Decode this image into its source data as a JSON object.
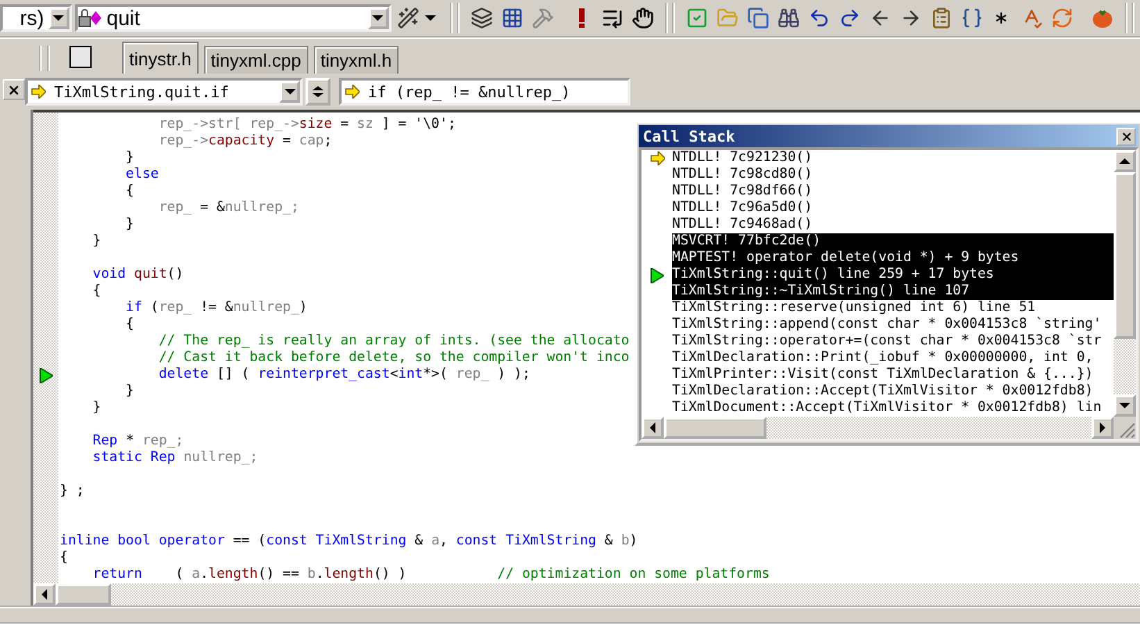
{
  "toolbar": {
    "config_combo": {
      "value": "rs)"
    },
    "symbol_combo": {
      "value": "quit"
    }
  },
  "tabs": [
    {
      "label": "tinystr.h",
      "selected": true
    },
    {
      "label": "tinyxml.cpp",
      "selected": false
    },
    {
      "label": "tinyxml.h",
      "selected": false
    }
  ],
  "wizard_bar": {
    "scope": "TiXmlString.quit.if",
    "member": "if (rep_ != &nullrep_)"
  },
  "editor": {
    "lines": [
      {
        "execution_mark": false,
        "tokens": [
          {
            "kind": "var",
            "text": "            rep_->str[ rep_->"
          },
          {
            "kind": "member",
            "text": "size"
          },
          {
            "kind": "plain",
            "text": " = "
          },
          {
            "kind": "var",
            "text": "sz"
          },
          {
            "kind": "plain",
            "text": " ] = '\\0';"
          }
        ]
      },
      {
        "execution_mark": false,
        "tokens": [
          {
            "kind": "var",
            "text": "            rep_->"
          },
          {
            "kind": "member",
            "text": "capacity"
          },
          {
            "kind": "plain",
            "text": " = "
          },
          {
            "kind": "var",
            "text": "cap"
          },
          {
            "kind": "plain",
            "text": ";"
          }
        ]
      },
      {
        "execution_mark": false,
        "tokens": [
          {
            "kind": "plain",
            "text": "        }"
          }
        ]
      },
      {
        "execution_mark": false,
        "tokens": [
          {
            "kind": "keyword",
            "text": "        else"
          }
        ]
      },
      {
        "execution_mark": false,
        "tokens": [
          {
            "kind": "plain",
            "text": "        {"
          }
        ]
      },
      {
        "execution_mark": false,
        "tokens": [
          {
            "kind": "var",
            "text": "            rep_"
          },
          {
            "kind": "plain",
            "text": " = &"
          },
          {
            "kind": "var",
            "text": "nullrep_;"
          }
        ]
      },
      {
        "execution_mark": false,
        "tokens": [
          {
            "kind": "plain",
            "text": "        }"
          }
        ]
      },
      {
        "execution_mark": false,
        "tokens": [
          {
            "kind": "plain",
            "text": "    }"
          }
        ]
      },
      {
        "execution_mark": false
      },
      {
        "execution_mark": false,
        "tokens": [
          {
            "kind": "keyword",
            "text": "    void "
          },
          {
            "kind": "member",
            "text": "quit"
          },
          {
            "kind": "plain",
            "text": "()"
          }
        ]
      },
      {
        "execution_mark": false,
        "tokens": [
          {
            "kind": "plain",
            "text": "    {"
          }
        ]
      },
      {
        "execution_mark": false,
        "tokens": [
          {
            "kind": "keyword",
            "text": "        if"
          },
          {
            "kind": "plain",
            "text": " ("
          },
          {
            "kind": "var",
            "text": "rep_"
          },
          {
            "kind": "plain",
            "text": " != &"
          },
          {
            "kind": "var",
            "text": "nullrep_"
          },
          {
            "kind": "plain",
            "text": ")"
          }
        ]
      },
      {
        "execution_mark": false,
        "tokens": [
          {
            "kind": "plain",
            "text": "        {"
          }
        ]
      },
      {
        "execution_mark": false,
        "tokens": [
          {
            "kind": "comment",
            "text": "            // The rep_ is really an array of ints. (see the allocato"
          }
        ]
      },
      {
        "execution_mark": false,
        "tokens": [
          {
            "kind": "comment",
            "text": "            // Cast it back before delete, so the compiler won't inco"
          }
        ]
      },
      {
        "execution_mark": true,
        "tokens": [
          {
            "kind": "keyword",
            "text": "            delete"
          },
          {
            "kind": "plain",
            "text": " [] ( "
          },
          {
            "kind": "keyword",
            "text": "reinterpret_cast"
          },
          {
            "kind": "plain",
            "text": "<"
          },
          {
            "kind": "keyword",
            "text": "int"
          },
          {
            "kind": "plain",
            "text": "*>( "
          },
          {
            "kind": "var",
            "text": "rep_"
          },
          {
            "kind": "plain",
            "text": " ) );"
          }
        ]
      },
      {
        "execution_mark": false,
        "tokens": [
          {
            "kind": "plain",
            "text": "        }"
          }
        ]
      },
      {
        "execution_mark": false,
        "tokens": [
          {
            "kind": "plain",
            "text": "    }"
          }
        ]
      },
      {
        "execution_mark": false
      },
      {
        "execution_mark": false,
        "tokens": [
          {
            "kind": "keyword",
            "text": "    Rep"
          },
          {
            "kind": "plain",
            "text": " * "
          },
          {
            "kind": "var",
            "text": "rep_;"
          }
        ]
      },
      {
        "execution_mark": false,
        "tokens": [
          {
            "kind": "keyword",
            "text": "    static Rep "
          },
          {
            "kind": "var",
            "text": "nullrep_;"
          }
        ]
      },
      {
        "execution_mark": false
      },
      {
        "execution_mark": false,
        "tokens": [
          {
            "kind": "plain",
            "text": "} ;"
          }
        ]
      },
      {
        "execution_mark": false
      },
      {
        "execution_mark": false
      },
      {
        "execution_mark": false,
        "tokens": [
          {
            "kind": "keyword",
            "text": "inline bool operator"
          },
          {
            "kind": "plain",
            "text": " == ("
          },
          {
            "kind": "keyword",
            "text": "const TiXmlString"
          },
          {
            "kind": "plain",
            "text": " & "
          },
          {
            "kind": "var",
            "text": "a"
          },
          {
            "kind": "plain",
            "text": ", "
          },
          {
            "kind": "keyword",
            "text": "const TiXmlString"
          },
          {
            "kind": "plain",
            "text": " & "
          },
          {
            "kind": "var",
            "text": "b"
          },
          {
            "kind": "plain",
            "text": ")"
          }
        ]
      },
      {
        "execution_mark": false,
        "tokens": [
          {
            "kind": "plain",
            "text": "{"
          }
        ]
      },
      {
        "execution_mark": false,
        "tokens": [
          {
            "kind": "keyword",
            "text": "    return"
          },
          {
            "kind": "plain",
            "text": "    ( "
          },
          {
            "kind": "var",
            "text": "a"
          },
          {
            "kind": "plain",
            "text": "."
          },
          {
            "kind": "member",
            "text": "length"
          },
          {
            "kind": "plain",
            "text": "() == "
          },
          {
            "kind": "var",
            "text": "b"
          },
          {
            "kind": "plain",
            "text": "."
          },
          {
            "kind": "member",
            "text": "length"
          },
          {
            "kind": "plain",
            "text": "() )           "
          },
          {
            "kind": "comment",
            "text": "// optimization on some platforms"
          }
        ]
      }
    ]
  },
  "call_stack": {
    "title": "Call Stack",
    "frames": [
      {
        "text": "NTDLL! 7c921230()",
        "current": true,
        "shown_in_editor": false,
        "selected": false
      },
      {
        "text": "NTDLL! 7c98cd80()",
        "current": false,
        "shown_in_editor": false,
        "selected": false
      },
      {
        "text": "NTDLL! 7c98df66()",
        "current": false,
        "shown_in_editor": false,
        "selected": false
      },
      {
        "text": "NTDLL! 7c96a5d0()",
        "current": false,
        "shown_in_editor": false,
        "selected": false
      },
      {
        "text": "NTDLL! 7c9468ad()",
        "current": false,
        "shown_in_editor": false,
        "selected": false
      },
      {
        "text": "MSVCRT! 77bfc2de()",
        "current": false,
        "shown_in_editor": false,
        "selected": true
      },
      {
        "text": "MAPTEST! operator delete(void *) + 9 bytes",
        "current": false,
        "shown_in_editor": false,
        "selected": true
      },
      {
        "text": "TiXmlString::quit() line 259 + 17 bytes",
        "current": false,
        "shown_in_editor": true,
        "selected": true
      },
      {
        "text": "TiXmlString::~TiXmlString() line 107",
        "current": false,
        "shown_in_editor": false,
        "selected": true
      },
      {
        "text": "TiXmlString::reserve(unsigned int 6) line 51",
        "current": false,
        "shown_in_editor": false,
        "selected": false
      },
      {
        "text": "TiXmlString::append(const char * 0x004153c8 `string'",
        "current": false,
        "shown_in_editor": false,
        "selected": false
      },
      {
        "text": "TiXmlString::operator+=(const char * 0x004153c8 `str",
        "current": false,
        "shown_in_editor": false,
        "selected": false
      },
      {
        "text": "TiXmlDeclaration::Print(_iobuf * 0x00000000, int 0,",
        "current": false,
        "shown_in_editor": false,
        "selected": false
      },
      {
        "text": "TiXmlPrinter::Visit(const TiXmlDeclaration & {...})",
        "current": false,
        "shown_in_editor": false,
        "selected": false
      },
      {
        "text": "TiXmlDeclaration::Accept(TiXmlVisitor * 0x0012fdb8)",
        "current": false,
        "shown_in_editor": false,
        "selected": false
      },
      {
        "text": "TiXmlDocument::Accept(TiXmlVisitor * 0x0012fdb8) lin",
        "current": false,
        "shown_in_editor": false,
        "selected": false
      }
    ]
  }
}
